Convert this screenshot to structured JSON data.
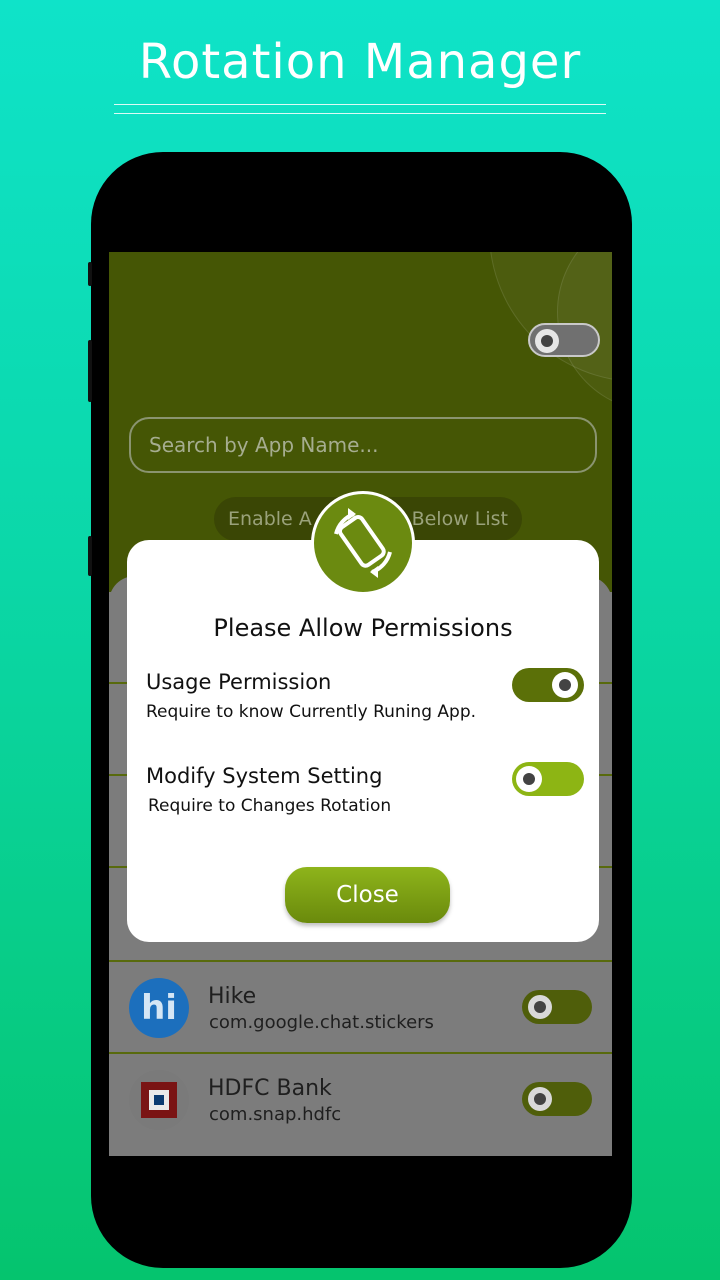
{
  "promo": {
    "title": "Rotation Manager"
  },
  "search": {
    "placeholder": "Search by App Name..."
  },
  "enable_bar": {
    "left": "Enable A",
    "right": "Below List"
  },
  "apps": [
    {
      "name": "Hike",
      "package": "com.google.chat.stickers",
      "icon": "hi",
      "enabled": false
    },
    {
      "name": "HDFC Bank",
      "package": "com.snap.hdfc",
      "icon": "hdfc-logo",
      "enabled": false
    }
  ],
  "dialog": {
    "title": "Please Allow Permissions",
    "permissions": [
      {
        "title": "Usage Permission",
        "description": "Require to know Currently Runing App.",
        "enabled": true
      },
      {
        "title": "Modify System Setting",
        "description": "Require to Changes Rotation",
        "enabled": false
      }
    ],
    "close_label": "Close"
  },
  "colors": {
    "accent": "#6b8a10",
    "header": "#455605",
    "background_top": "#0fe3c9",
    "background_bottom": "#05c46e"
  }
}
